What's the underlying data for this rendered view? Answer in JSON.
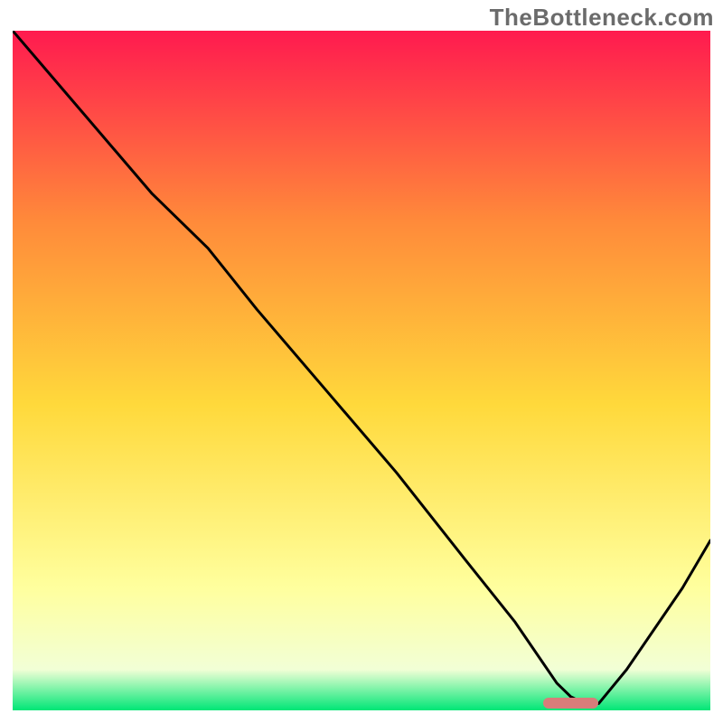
{
  "watermark": "TheBottleneck.com",
  "colors": {
    "gradient_top": "#ff1a4f",
    "gradient_upper_mid": "#ff8a3a",
    "gradient_mid": "#ffd93b",
    "gradient_lower_mid": "#ffff9e",
    "gradient_near_bottom": "#f2ffd6",
    "gradient_bottom": "#00e676",
    "curve": "#000000",
    "marker": "#d87d7a"
  },
  "chart_data": {
    "type": "line",
    "title": "",
    "xlabel": "",
    "ylabel": "",
    "x": [
      0,
      5,
      10,
      15,
      20,
      28,
      35,
      45,
      55,
      65,
      72,
      76,
      78,
      80,
      82,
      84,
      88,
      92,
      96,
      100
    ],
    "values": [
      100,
      94,
      88,
      82,
      76,
      68,
      59,
      47,
      35,
      22,
      13,
      7,
      4,
      2,
      1,
      1,
      6,
      12,
      18,
      25
    ],
    "xlim": [
      0,
      100
    ],
    "ylim": [
      0,
      100
    ],
    "marker_range_x": [
      76,
      84
    ],
    "marker_y": 1,
    "annotations": []
  }
}
